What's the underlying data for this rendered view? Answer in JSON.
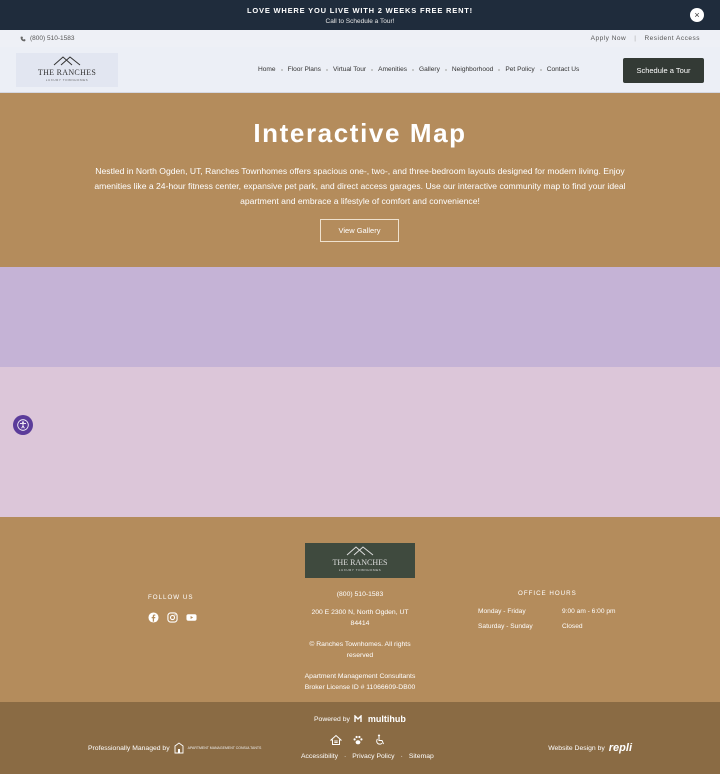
{
  "promo": {
    "headline": "LOVE WHERE YOU LIVE WITH 2 WEEKS FREE RENT!",
    "subline": "Call to Schedule a Tour!",
    "close_label": "×"
  },
  "utility": {
    "phone": "(800) 510-1583",
    "apply": "Apply Now",
    "sep": "|",
    "resident": "Resident Access"
  },
  "header": {
    "logo_name": "THE RANCHES",
    "logo_sub": "LUXURY TOWNHOMES",
    "nav": [
      "Home",
      "Floor Plans",
      "Virtual Tour",
      "Amenities",
      "Gallery",
      "Neighborhood",
      "Pet Policy",
      "Contact Us"
    ],
    "cta": "Schedule a Tour"
  },
  "hero": {
    "title": "Interactive Map",
    "description": "Nestled in North Ogden, UT, Ranches Townhomes offers spacious one-, two-, and three-bedroom layouts designed for modern living. Enjoy amenities like a 24-hour fitness center, expansive pet park, and direct access garages. Use our interactive community map to find your ideal apartment and embrace a lifestyle of comfort and convenience!",
    "button": "View Gallery"
  },
  "footer": {
    "logo_name": "THE RANCHES",
    "logo_sub": "LUXURY TOWNHOMES",
    "follow": "FOLLOW US",
    "phone": "(800) 510-1583",
    "address_line1": "200 E 2300 N, North Ogden, UT",
    "address_line2": "84414",
    "copyright": "© Ranches Townhomes. All rights reserved",
    "manager": "Apartment Management Consultants",
    "broker": "Broker License ID # 11066609-DB00",
    "hours_title": "OFFICE HOURS",
    "hours": [
      {
        "day": "Monday - Friday",
        "time": "9:00 am - 6:00 pm"
      },
      {
        "day": "Saturday - Sunday",
        "time": "Closed"
      }
    ]
  },
  "bottom": {
    "powered_by": "Powered by",
    "powered_brand": "multihub",
    "managed_by": "Professionally Managed by",
    "managed_brand": "APARTMENT MANAGEMENT CONSULTANTS",
    "links": [
      "Accessibility",
      "Privacy Policy",
      "Sitemap"
    ],
    "link_sep": "·",
    "design_by": "Website Design by",
    "design_brand": "repli"
  },
  "colors": {
    "page_bg": "#b48c5c",
    "promo_bg": "#1f2c3c",
    "header_bg": "#eceff6",
    "cta_bg": "#333a35",
    "map_top": "#c5b3d6",
    "map_bottom": "#dcc6d9",
    "bottom_bar": "#8a6b44",
    "accessibility": "#5b3c9a"
  }
}
